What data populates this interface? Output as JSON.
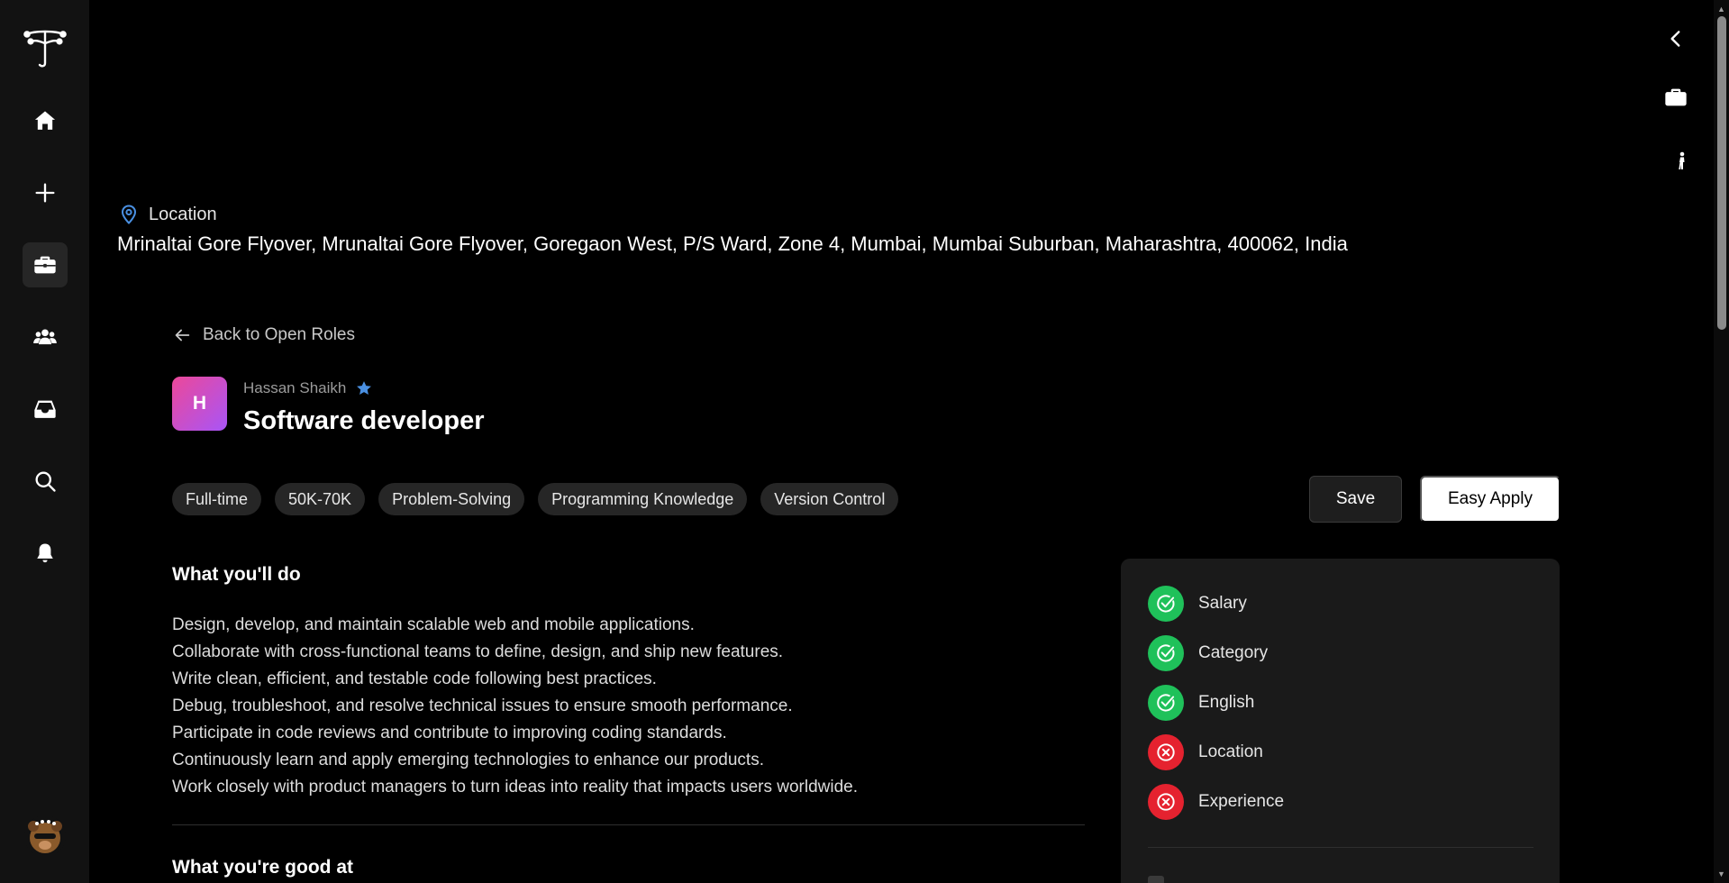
{
  "sidebar": {
    "logo": "tree-logo-icon",
    "items": [
      {
        "name": "home",
        "icon": "home-icon"
      },
      {
        "name": "create",
        "icon": "plus-icon"
      },
      {
        "name": "jobs",
        "icon": "briefcase-icon",
        "active": true
      },
      {
        "name": "community",
        "icon": "people-icon"
      },
      {
        "name": "inbox",
        "icon": "inbox-icon"
      },
      {
        "name": "search",
        "icon": "search-icon"
      },
      {
        "name": "notifications",
        "icon": "bell-icon"
      }
    ],
    "avatar": "user-avatar"
  },
  "right_rail": {
    "items": [
      {
        "icon": "chevron-left-icon"
      },
      {
        "icon": "briefcase-icon"
      },
      {
        "icon": "person-walking-icon"
      }
    ]
  },
  "location": {
    "label": "Location",
    "address": "Mrinaltai Gore Flyover, Mrunaltai Gore Flyover, Goregaon West, P/S Ward, Zone 4, Mumbai, Mumbai Suburban, Maharashtra, 400062, India"
  },
  "back_link": {
    "label": "Back to Open Roles"
  },
  "job": {
    "company_initial": "H",
    "poster_name": "Hassan Shaikh",
    "title": "Software developer",
    "tags": [
      "Full-time",
      "50K-70K",
      "Problem-Solving",
      "Programming Knowledge",
      "Version Control"
    ]
  },
  "actions": {
    "save_label": "Save",
    "apply_label": "Easy Apply"
  },
  "what_youll_do": {
    "heading": "What you'll do",
    "items": [
      "Design, develop, and maintain scalable web and mobile applications.",
      "Collaborate with cross-functional teams to define, design, and ship new features.",
      "Write clean, efficient, and testable code following best practices.",
      "Debug, troubleshoot, and resolve technical issues to ensure smooth performance.",
      "Participate in code reviews and contribute to improving coding standards.",
      "Continuously learn and apply emerging technologies to enhance our products.",
      "Work closely with product managers to turn ideas into reality that impacts users worldwide."
    ]
  },
  "what_youre_good_at": {
    "heading": "What you're good at"
  },
  "match": {
    "criteria": [
      {
        "label": "Salary",
        "status": "met"
      },
      {
        "label": "Category",
        "status": "met"
      },
      {
        "label": "English",
        "status": "met"
      },
      {
        "label": "Location",
        "status": "unmet"
      },
      {
        "label": "Experience",
        "status": "unmet"
      }
    ]
  },
  "colors": {
    "met": "#1fc15a",
    "unmet": "#e5222f",
    "brand_gradient_start": "#ec4899",
    "brand_gradient_end": "#a855f7",
    "verified": "#4a90e2"
  }
}
